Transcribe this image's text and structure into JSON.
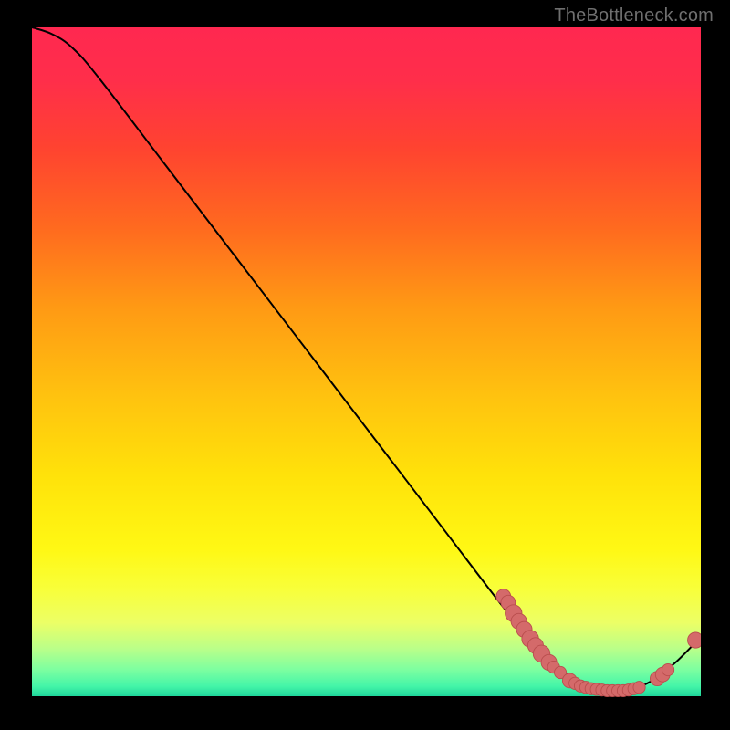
{
  "attribution": "TheBottleneck.com",
  "colors": {
    "dot": "#d46a6a",
    "dot_stroke": "#b94d4d",
    "curve": "#000000",
    "gradient_stops": [
      {
        "offset": 0.0,
        "color": "#ff2850"
      },
      {
        "offset": 0.08,
        "color": "#ff2e4a"
      },
      {
        "offset": 0.18,
        "color": "#ff4330"
      },
      {
        "offset": 0.3,
        "color": "#ff6a1f"
      },
      {
        "offset": 0.42,
        "color": "#ff9a14"
      },
      {
        "offset": 0.55,
        "color": "#ffc20f"
      },
      {
        "offset": 0.67,
        "color": "#ffe20a"
      },
      {
        "offset": 0.78,
        "color": "#fff814"
      },
      {
        "offset": 0.84,
        "color": "#f8ff3a"
      },
      {
        "offset": 0.89,
        "color": "#ecff66"
      },
      {
        "offset": 0.93,
        "color": "#b8ff8a"
      },
      {
        "offset": 0.96,
        "color": "#7dffa0"
      },
      {
        "offset": 0.985,
        "color": "#44f5a8"
      },
      {
        "offset": 1.0,
        "color": "#1fd69b"
      }
    ]
  },
  "chart_data": {
    "type": "line",
    "title": "",
    "xlabel": "",
    "ylabel": "",
    "xlim": [
      0,
      100
    ],
    "ylim": [
      0,
      100
    ],
    "curve": [
      {
        "x": 0.0,
        "y": 100.0
      },
      {
        "x": 3.0,
        "y": 99.0
      },
      {
        "x": 6.0,
        "y": 97.0
      },
      {
        "x": 10.0,
        "y": 92.5
      },
      {
        "x": 20.0,
        "y": 79.5
      },
      {
        "x": 30.0,
        "y": 66.5
      },
      {
        "x": 40.0,
        "y": 53.5
      },
      {
        "x": 50.0,
        "y": 40.5
      },
      {
        "x": 60.0,
        "y": 27.5
      },
      {
        "x": 70.0,
        "y": 14.5
      },
      {
        "x": 75.0,
        "y": 8.5
      },
      {
        "x": 80.0,
        "y": 4.0
      },
      {
        "x": 84.0,
        "y": 1.8
      },
      {
        "x": 88.0,
        "y": 1.4
      },
      {
        "x": 92.0,
        "y": 2.6
      },
      {
        "x": 96.0,
        "y": 5.5
      },
      {
        "x": 100.0,
        "y": 9.5
      }
    ],
    "dots": [
      {
        "x": 70.5,
        "y": 15.5,
        "r": 1.2
      },
      {
        "x": 71.2,
        "y": 14.6,
        "r": 1.2
      },
      {
        "x": 72.0,
        "y": 13.0,
        "r": 1.4
      },
      {
        "x": 72.8,
        "y": 11.8,
        "r": 1.3
      },
      {
        "x": 73.6,
        "y": 10.6,
        "r": 1.3
      },
      {
        "x": 74.5,
        "y": 9.2,
        "r": 1.4
      },
      {
        "x": 75.3,
        "y": 8.2,
        "r": 1.3
      },
      {
        "x": 76.2,
        "y": 7.0,
        "r": 1.4
      },
      {
        "x": 77.3,
        "y": 5.7,
        "r": 1.3
      },
      {
        "x": 78.0,
        "y": 5.0,
        "r": 1.0
      },
      {
        "x": 79.0,
        "y": 4.2,
        "r": 1.0
      },
      {
        "x": 80.4,
        "y": 3.0,
        "r": 1.2
      },
      {
        "x": 81.2,
        "y": 2.6,
        "r": 1.0
      },
      {
        "x": 82.0,
        "y": 2.2,
        "r": 1.0
      },
      {
        "x": 82.8,
        "y": 2.0,
        "r": 1.0
      },
      {
        "x": 83.6,
        "y": 1.8,
        "r": 1.0
      },
      {
        "x": 84.4,
        "y": 1.7,
        "r": 1.0
      },
      {
        "x": 85.2,
        "y": 1.6,
        "r": 1.0
      },
      {
        "x": 86.0,
        "y": 1.5,
        "r": 1.0
      },
      {
        "x": 86.8,
        "y": 1.5,
        "r": 1.0
      },
      {
        "x": 87.6,
        "y": 1.5,
        "r": 1.0
      },
      {
        "x": 88.4,
        "y": 1.5,
        "r": 1.0
      },
      {
        "x": 89.2,
        "y": 1.6,
        "r": 1.0
      },
      {
        "x": 90.0,
        "y": 1.8,
        "r": 1.0
      },
      {
        "x": 90.8,
        "y": 2.0,
        "r": 1.0
      },
      {
        "x": 93.5,
        "y": 3.3,
        "r": 1.2
      },
      {
        "x": 94.3,
        "y": 3.9,
        "r": 1.2
      },
      {
        "x": 95.1,
        "y": 4.6,
        "r": 1.0
      },
      {
        "x": 99.2,
        "y": 9.0,
        "r": 1.3
      }
    ]
  }
}
